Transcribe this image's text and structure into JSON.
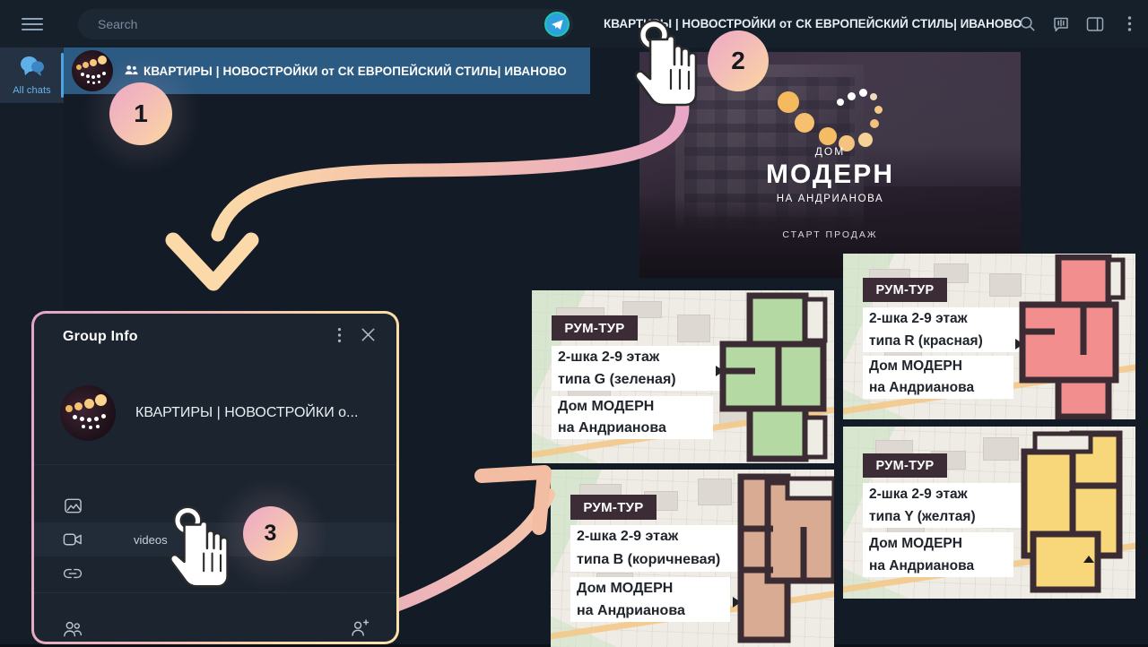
{
  "app": {
    "name": "Telegram Web",
    "theme_bg": "#121b26",
    "accent": "#4ea4e0"
  },
  "rail": {
    "menu_icon": "hamburger-menu-icon",
    "items": [
      {
        "icon": "chats-bubble-icon",
        "label": "All chats",
        "selected": true
      }
    ]
  },
  "search": {
    "placeholder": "Search",
    "value": "",
    "send_icon": "telegram-paper-plane-icon"
  },
  "chat_list": {
    "rows": [
      {
        "title": "КВАРТИРЫ | НОВОСТРОЙКИ от СК ЕВРОПЕЙСКИЙ СТИЛЬ| ИВАНОВО",
        "group_icon": "people-group-icon",
        "selected": true
      }
    ]
  },
  "chat_header": {
    "title": "КВАРТИРЫ | НОВОСТРОЙКИ от СК ЕВРОПЕЙСКИЙ СТИЛЬ| ИВАНОВО",
    "icons": [
      {
        "name": "search-icon"
      },
      {
        "name": "voice-chat-icon"
      },
      {
        "name": "toggle-sidebar-icon"
      },
      {
        "name": "more-options-icon"
      }
    ]
  },
  "banner": {
    "kicker": "ДОМ",
    "title": "МОДЕРН",
    "subtitle": "НА АНДРИАНОВА",
    "footer": "СТАРТ ПРОДАЖ"
  },
  "videos": [
    {
      "id": "video-green",
      "badge": "РУМ-ТУР",
      "line1": "2-шка 2-9 этаж",
      "line2": "типа G (зеленая)",
      "line3": "Дом МОДЕРН",
      "line4": "на Андрианова",
      "plan_color": "#b5d9a2",
      "plan_stroke": "#3b2c33"
    },
    {
      "id": "video-red",
      "badge": "РУМ-ТУР",
      "line1": "2-шка 2-9 этаж",
      "line2": "типа R (красная)",
      "line3": "Дом МОДЕРН",
      "line4": "на Андрианова",
      "plan_color": "#f38e8e",
      "plan_stroke": "#3b2c33"
    },
    {
      "id": "video-brown",
      "badge": "РУМ-ТУР",
      "line1": "2-шка 2-9 этаж",
      "line2": "типа B (коричневая)",
      "line3": "Дом МОДЕРН",
      "line4": "на Андрианова",
      "plan_color": "#d9ab93",
      "plan_stroke": "#3b2c33"
    },
    {
      "id": "video-yellow",
      "badge": "РУМ-ТУР",
      "line1": "2-шка 2-9 этаж",
      "line2": "типа Y (желтая)",
      "line3": "Дом МОДЕРН",
      "line4": "на Андрианова",
      "plan_color": "#f7d77a",
      "plan_stroke": "#3b2c33"
    }
  ],
  "group_info": {
    "title": "Group Info",
    "more_icon": "more-options-icon",
    "close_icon": "close-icon",
    "group_name": "КВАРТИРЫ | НОВОСТРОЙКИ о...",
    "tabs": [
      {
        "icon": "photo-icon",
        "label": "",
        "selected": false
      },
      {
        "icon": "video-camera-icon",
        "label": "videos",
        "selected": true
      },
      {
        "icon": "link-icon",
        "label": "",
        "selected": false
      }
    ],
    "members_icon": "members-icon",
    "add_member_icon": "add-member-icon"
  },
  "steps": [
    {
      "number": "1"
    },
    {
      "number": "2"
    },
    {
      "number": "3"
    }
  ],
  "annotation_colors": {
    "arrow_peach": "#f8cfa0",
    "arrow_pink": "#e5a4c4",
    "bubble_gradient_start": "#eda9c6",
    "bubble_gradient_end": "#fbd79f"
  }
}
